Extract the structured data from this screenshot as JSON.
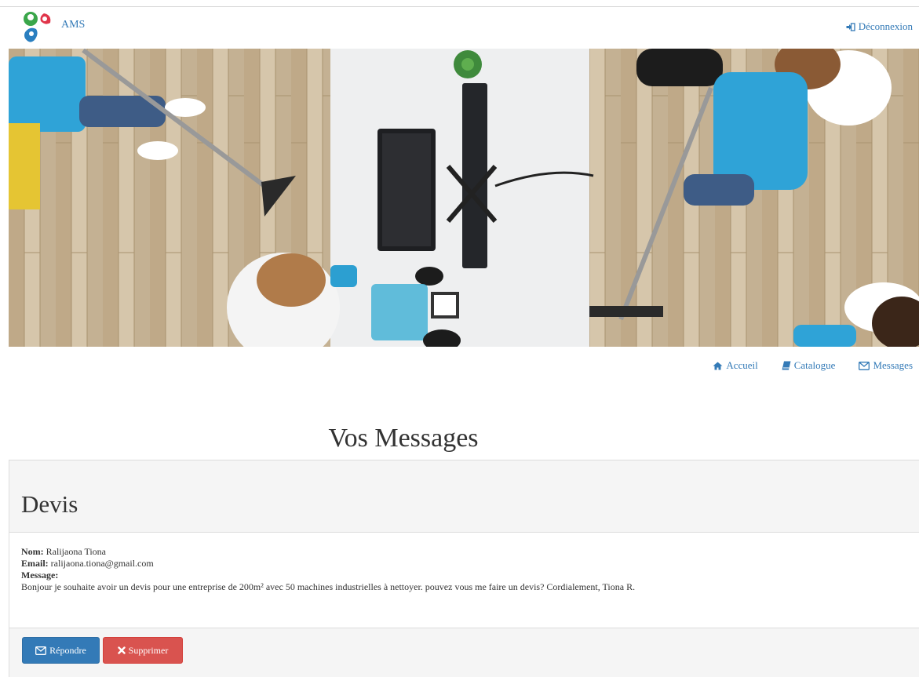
{
  "header": {
    "brand": "AMS",
    "logout_label": "Déconnexion"
  },
  "nav": {
    "items": [
      {
        "label": "Accueil",
        "icon": "home-icon"
      },
      {
        "label": "Catalogue",
        "icon": "book-icon"
      },
      {
        "label": "Messages",
        "icon": "envelope-icon"
      }
    ]
  },
  "page": {
    "title": "Vos Messages"
  },
  "message": {
    "subject": "Devis",
    "name_label": "Nom:",
    "name": "Ralijaona Tiona",
    "email_label": "Email:",
    "email": "ralijaona.tiona@gmail.com",
    "message_label": "Message:",
    "body": "Bonjour je souhaite avoir un devis pour une entreprise de 200m² avec 50 machines industrielles à nettoyer. pouvez vous me faire un devis? Cordialement, Tiona R."
  },
  "actions": {
    "reply_label": "Répondre",
    "delete_label": "Supprimer"
  },
  "colors": {
    "primary": "#337ab7",
    "danger": "#d9534f",
    "panel_bg": "#f5f5f5"
  }
}
